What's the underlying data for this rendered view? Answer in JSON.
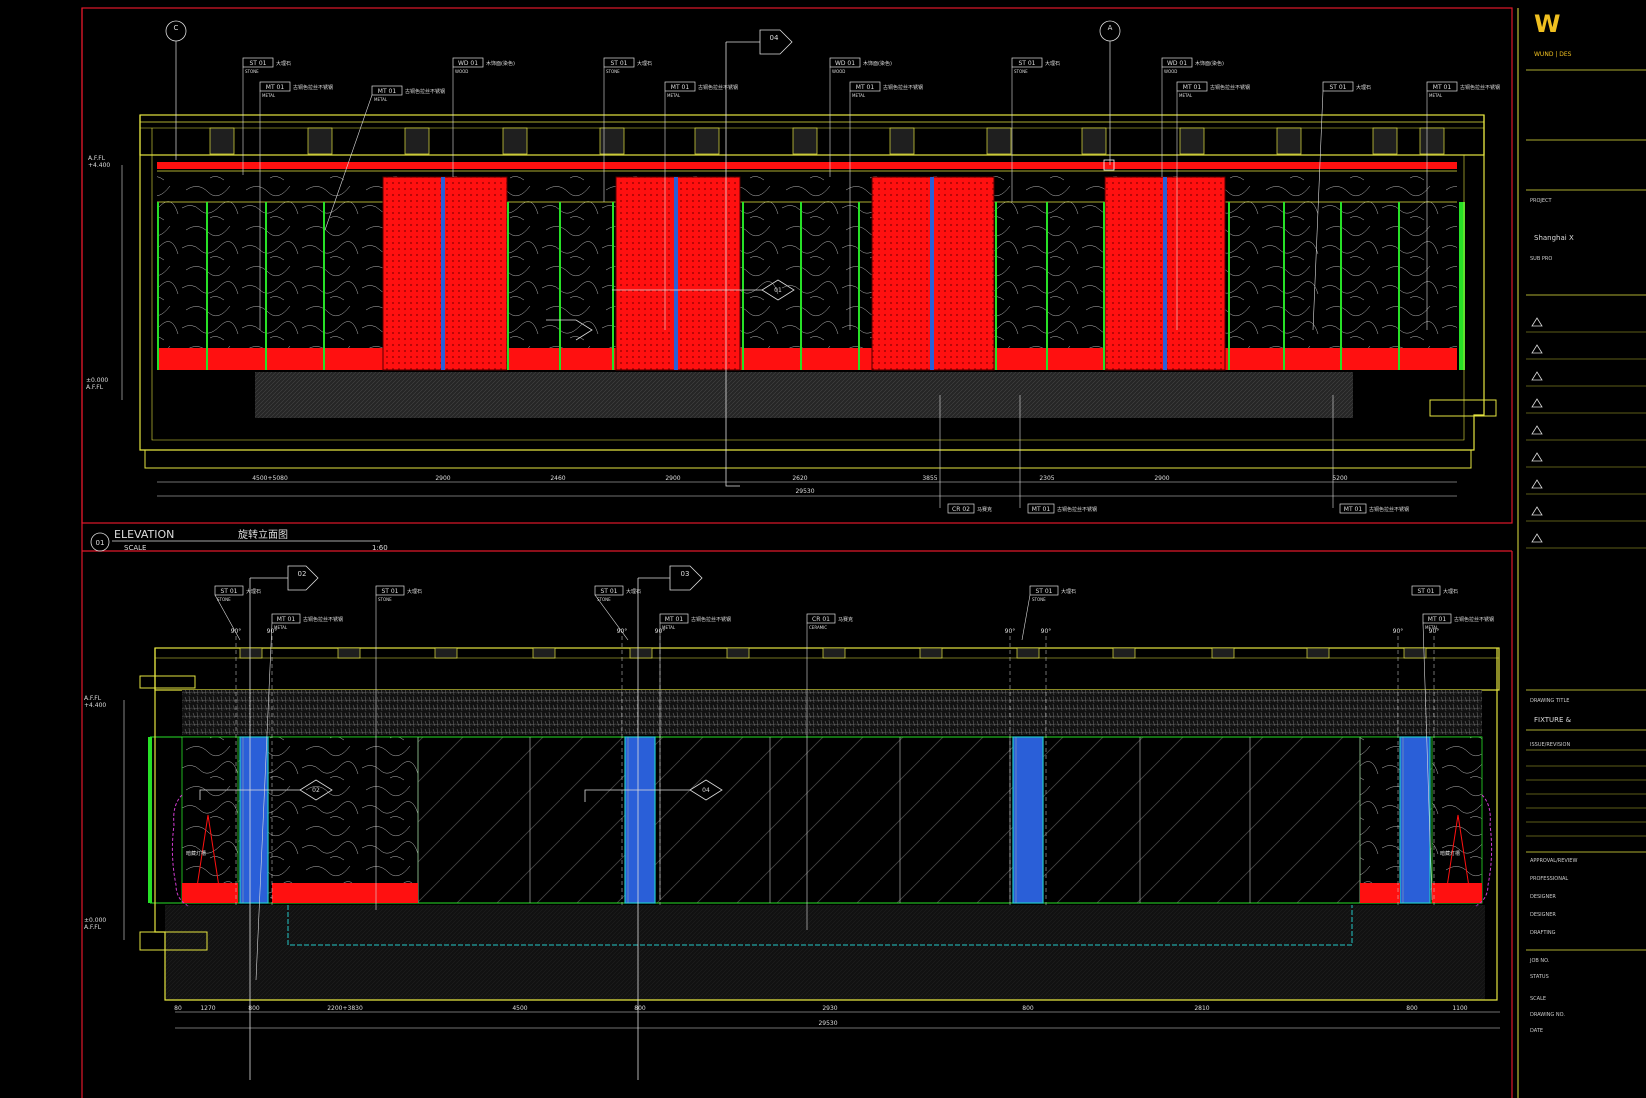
{
  "colors": {
    "background": "#000000",
    "frame": "#e0182a",
    "outline": "#e5e540",
    "panel_red": "#ff1010",
    "leader": "#ffffff",
    "stone_dark": "#1a1a1a",
    "green": "#27e027",
    "blue": "#2a5fd8",
    "cyan": "#22c7c7",
    "magenta": "#d03ad0",
    "gray_fill": "#3a3a3a"
  },
  "title_block": {
    "logo": "W",
    "logo_sub": "WUND | DES",
    "project_label": "PROJECT",
    "city": "Shanghai X",
    "sub_project": "SUB PRO",
    "drawing_title_label": "DRAWING TITLE",
    "drawing_title": "FIXTURE &",
    "issue_label": "ISSUE/REVISION",
    "approval": "APPROVAL/REVIEW",
    "professional": "PROFESSIONAL",
    "designer": "DESIGNER",
    "drafting": "DRAFTING",
    "job_no": "JOB NO.",
    "status": "STATUS",
    "scale": "SCALE",
    "drawing_no": "DRAWING NO.",
    "date": "DATE"
  },
  "elevation1": {
    "number": "01",
    "title": "ELEVATION",
    "title_cn": "旋转立面图",
    "scale_label": "SCALE",
    "scale_value": "1:60",
    "level_top": "A.F.FL\n+4.400",
    "level_bottom": "±0.000\nA.F.FL",
    "dims": [
      "4500+5080",
      "2900",
      "2460",
      "2900",
      "2620",
      "3855",
      "2305",
      "2900",
      "5200"
    ],
    "total_dim": "29530",
    "tags_top": [
      {
        "code": "ST 01",
        "sub": "STONE",
        "cn": "大理石"
      },
      {
        "code": "WD 01",
        "sub": "WOOD",
        "cn": "木饰面(染色)"
      },
      {
        "code": "MT 01",
        "sub": "METAL",
        "cn": "古铜色拉丝不锈钢"
      },
      {
        "code": "ST 01",
        "sub": "STONE",
        "cn": "大理石"
      },
      {
        "code": "WD 01",
        "sub": "WOOD",
        "cn": "木饰面(染色)"
      },
      {
        "code": "ST 01",
        "sub": "STONE",
        "cn": "大理石"
      },
      {
        "code": "WD 01",
        "sub": "WOOD",
        "cn": "木饰面(染色)"
      }
    ],
    "tags_bottom": [
      {
        "code": "CR 02",
        "sub": "CERAMIC",
        "cn": "马赛克"
      },
      {
        "code": "MT 01",
        "sub": "METAL",
        "cn": "古铜色拉丝不锈钢"
      },
      {
        "code": "MT 01",
        "sub": "METAL",
        "cn": "古铜色拉丝不锈钢"
      }
    ]
  },
  "elevation2": {
    "level_top": "A.F.FL\n+4.400",
    "level_bottom": "±0.000\nA.F.FL",
    "dims": [
      "80",
      "1270",
      "800",
      "2200+3830",
      "4500",
      "800",
      "2930",
      "800",
      "2810",
      "800",
      "1100"
    ],
    "total_dim": "29530",
    "tags_top": [
      {
        "code": "ST 01",
        "sub": "STONE",
        "cn": "大理石"
      },
      {
        "code": "ST 01",
        "sub": "STONE",
        "cn": "大理石"
      },
      {
        "code": "MT 01",
        "sub": "METAL",
        "cn": "古铜色拉丝不锈钢"
      },
      {
        "code": "ST 01",
        "sub": "STONE",
        "cn": "大理石"
      },
      {
        "code": "MT 01",
        "sub": "METAL",
        "cn": "古铜色拉丝不锈钢"
      },
      {
        "code": "CR 01",
        "sub": "CERAMIC",
        "cn": "马赛克"
      },
      {
        "code": "ST 01",
        "sub": "STONE",
        "cn": "大理石"
      },
      {
        "code": "MT 01",
        "sub": "METAL",
        "cn": "古铜色拉丝不锈钢"
      }
    ],
    "angle_label": "90°",
    "stone_note": "暗藏灯槽"
  },
  "callouts": {
    "section_c": "C",
    "section_a": "A",
    "detail_04": "04",
    "detail_01": "01",
    "detail_02": "02",
    "detail_03": "03"
  }
}
